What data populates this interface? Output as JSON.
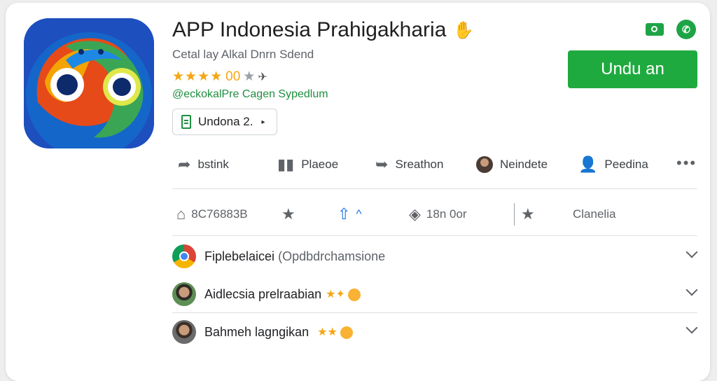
{
  "app": {
    "title": "APP Indonesia Prahigakharia",
    "developer": "Cetal lay Alkal Dnrn Sdend",
    "rating_value": "00",
    "category": "@eckokalPre Cagen Sypedlum",
    "chip_label": "Undona 2."
  },
  "install_button": {
    "label": "Undu an"
  },
  "actions": [
    {
      "label": "bstink",
      "icon": "share-icon"
    },
    {
      "label": "Plaeoe",
      "icon": "chart-icon"
    },
    {
      "label": "Sreathon",
      "icon": "forward-icon"
    },
    {
      "label": "Neindete",
      "icon": "avatar"
    },
    {
      "label": "Peedina",
      "icon": "person-icon"
    }
  ],
  "stats": [
    {
      "label": "8C76883B",
      "icon": "home-icon"
    },
    {
      "label": "",
      "icon": "star-icon"
    },
    {
      "label": "",
      "icon": "thumb-icon"
    },
    {
      "label": "18n 0or",
      "icon": "tag-icon"
    },
    {
      "label": "",
      "icon": "star-icon"
    },
    {
      "label": "Clanelia",
      "icon": ""
    }
  ],
  "reviews": [
    {
      "name": "Fiplebelaicei",
      "suffix": "(Opdbdrchamsione"
    },
    {
      "name": "Aidlecsia prelraabian",
      "suffix": ""
    },
    {
      "name": "Bahmeh lagngikan",
      "suffix": ""
    }
  ],
  "colors": {
    "accent": "#1faa3f",
    "star": "#f4a614",
    "category": "#1e8e3e"
  }
}
